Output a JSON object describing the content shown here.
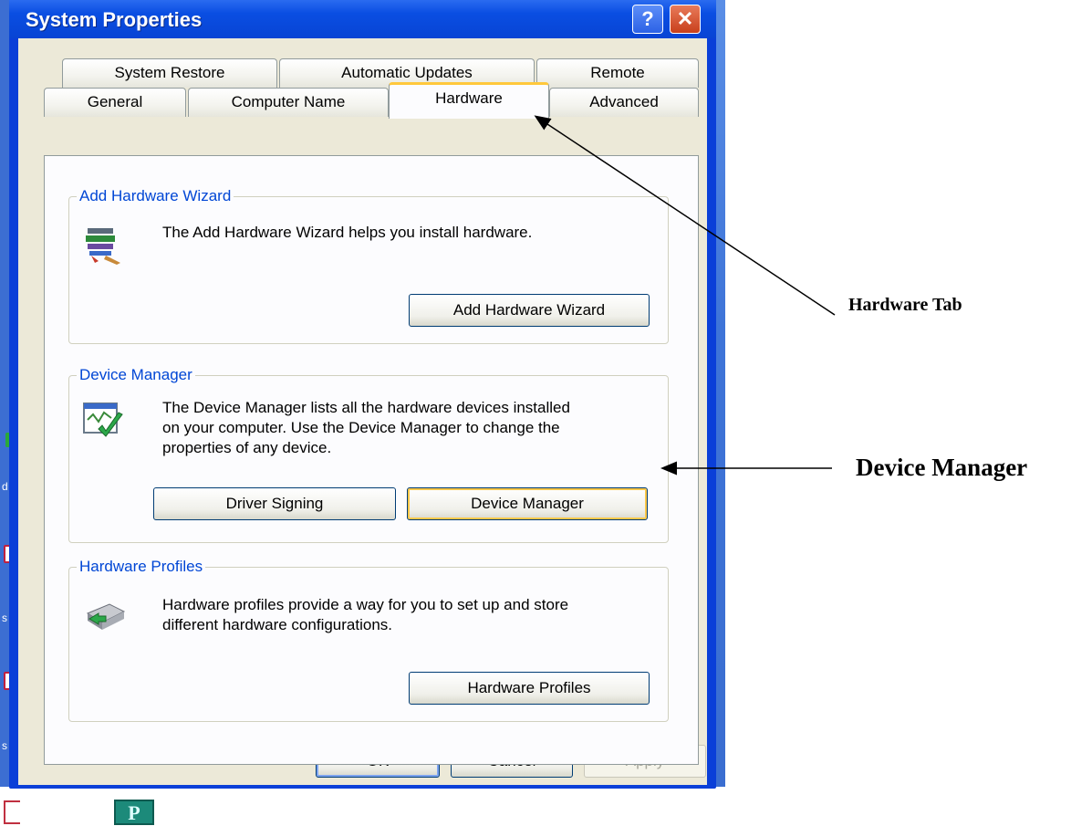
{
  "dialog": {
    "title": "System Properties",
    "help_btn": "?",
    "close_btn": "✕"
  },
  "tabs_row1": [
    "System Restore",
    "Automatic Updates",
    "Remote"
  ],
  "tabs_row2": [
    "General",
    "Computer Name",
    "Hardware",
    "Advanced"
  ],
  "active_tab": "Hardware",
  "groups": {
    "add_hardware": {
      "title": "Add Hardware Wizard",
      "description": "The Add Hardware Wizard helps you install hardware.",
      "button": "Add Hardware Wizard"
    },
    "device_manager": {
      "title": "Device Manager",
      "description_lines": [
        "The Device Manager lists all the hardware devices installed",
        "on your computer. Use the Device Manager to change the",
        "properties of any device."
      ],
      "button_driver": "Driver Signing",
      "button_device": "Device Manager"
    },
    "hardware_profiles": {
      "title": "Hardware Profiles",
      "description_lines": [
        "Hardware profiles provide a way for you to set up and store",
        "different hardware configurations."
      ],
      "button": "Hardware Profiles"
    }
  },
  "footer": {
    "ok": "OK",
    "cancel": "Cancel",
    "apply": "Apply"
  },
  "annotations": {
    "hardware_tab": "Hardware Tab",
    "device_manager": "Device Manager"
  },
  "desktop": {
    "label_d": "d",
    "label_s1": "s",
    "label_s2": "s",
    "bottom_icon_letter": "P"
  }
}
